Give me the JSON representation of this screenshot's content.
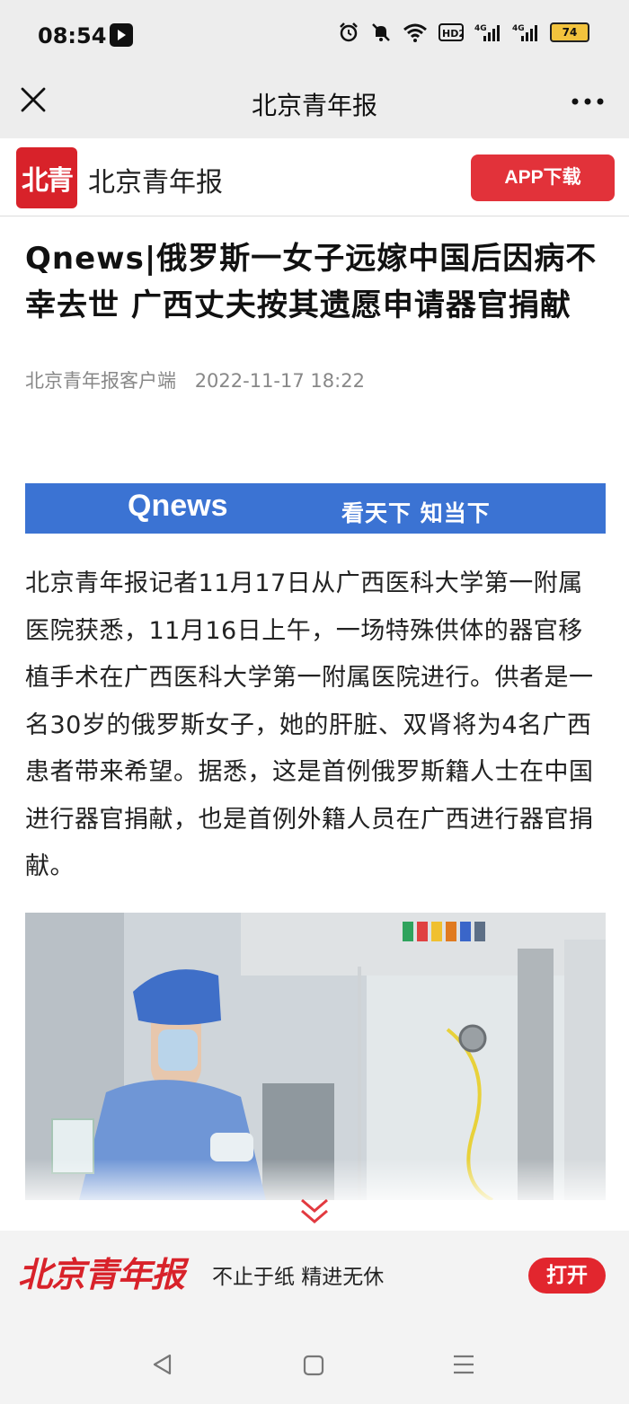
{
  "status_bar": {
    "time": "08:54",
    "network_badges": [
      "HD2",
      "4G",
      "4G"
    ],
    "battery": "74",
    "icons": [
      "tiktok-icon",
      "alarm-icon",
      "mute-icon",
      "wifi-icon",
      "hd-icon",
      "signal-icon",
      "signal-icon",
      "battery-icon"
    ]
  },
  "nav": {
    "title": "北京青年报",
    "close_icon": "close-icon",
    "more_icon": "more-icon"
  },
  "brand": {
    "logo_text": "北青",
    "name": "北京青年报",
    "app_button": "APP下载"
  },
  "article": {
    "title": "Qnews|俄罗斯一女子远嫁中国后因病不幸去世 广西丈夫按其遗愿申请器官捐献",
    "source": "北京青年报客户端",
    "date": "2022-11-17 18:22",
    "banner": {
      "logo": "Qnews",
      "slogan": "看天下  知当下",
      "color": "#3b73d3"
    },
    "body": "北京青年报记者11月17日从广西医科大学第一附属医院获悉，11月16日上午，一场特殊供体的器官移植手术在广西医科大学第一附属医院进行。供者是一名30岁的俄罗斯女子，她的肝脏、双肾将为4名广西患者带来希望。据悉，这是首例俄罗斯籍人士在中国进行器官捐献，也是首例外籍人员在广西进行器官捐献。"
  },
  "footer": {
    "logo": "北京青年报",
    "slogan": "不止于纸 精进无休",
    "open_button": "打开",
    "accent": "#e2262e"
  },
  "system_nav": {
    "icons": [
      "back-icon",
      "home-icon",
      "menu-icon"
    ]
  }
}
